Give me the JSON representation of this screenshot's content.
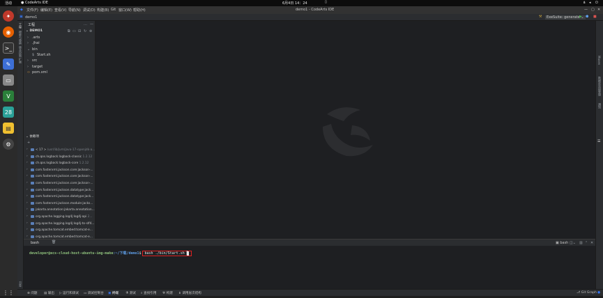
{
  "system_bar": {
    "activities": "活动",
    "app_name": "CodeArts IDE",
    "clock": "6月4日  14：24"
  },
  "window": {
    "title": "demo1 - CodeArts IDE"
  },
  "menu": {
    "items": [
      "文件(F)",
      "编辑(E)",
      "查看(V)",
      "导航(N)",
      "调试(D)",
      "构建(B)",
      "Git",
      "窗口(W)",
      "帮助(H)"
    ]
  },
  "toolbar": {
    "project_tab": "demo1",
    "run_config": "ExeSuite: generate"
  },
  "left_strip": {
    "labels": [
      "工程",
      "搜索与替换",
      "版本控制",
      "扩展"
    ],
    "bottom_label": "书签"
  },
  "right_strip": {
    "labels": [
      "Maven",
      "数据库连接管理",
      "通知"
    ]
  },
  "project": {
    "header": "工程",
    "root": "DEMO1",
    "tree": [
      {
        "name": ".arts",
        "kind": "folder",
        "indent": 0,
        "arrow": "›"
      },
      {
        "name": ".jhai",
        "kind": "folder",
        "indent": 0,
        "arrow": "›"
      },
      {
        "name": "bin",
        "kind": "folder",
        "indent": 0,
        "arrow": "⌄"
      },
      {
        "name": "Start.sh",
        "kind": "file",
        "indent": 1,
        "arrow": "$"
      },
      {
        "name": "src",
        "kind": "folder",
        "indent": 0,
        "arrow": "›"
      },
      {
        "name": "target",
        "kind": "folder",
        "indent": 0,
        "arrow": "›"
      },
      {
        "name": "pom.xml",
        "kind": "xml",
        "indent": 0,
        "arrow": "‹›"
      }
    ]
  },
  "deps": {
    "header": "依赖项",
    "items": [
      {
        "name": "< 17 > ",
        "version": "/usr/lib/jvm/java-17-openjdk-a..."
      },
      {
        "name": "ch.qos.logback:logback-classic ",
        "version": "1.2.12"
      },
      {
        "name": "ch.qos.logback:logback-core ",
        "version": "1.2.12"
      },
      {
        "name": "com.fasterxml.jackson.core:jackson-...",
        "version": ""
      },
      {
        "name": "com.fasterxml.jackson.core:jackson-...",
        "version": ""
      },
      {
        "name": "com.fasterxml.jackson.core:jackson-...",
        "version": ""
      },
      {
        "name": "com.fasterxml.jackson.datatype:jack...",
        "version": ""
      },
      {
        "name": "com.fasterxml.jackson.datatype:jack...",
        "version": ""
      },
      {
        "name": "com.fasterxml.jackson.module:jacks...",
        "version": ""
      },
      {
        "name": "jakarta.annotation:jakarta.annotation...",
        "version": ""
      },
      {
        "name": "org.apache.logging.log4j:log4j-api ",
        "version": "2..."
      },
      {
        "name": "org.apache.logging.log4j:log4j-to-slf4...",
        "version": ""
      },
      {
        "name": "org.apache.tomcat.embed:tomcat-e...",
        "version": ""
      },
      {
        "name": "org.apache.tomcat.embed:tomcat-e...",
        "version": ""
      }
    ]
  },
  "terminal": {
    "tab": "bash",
    "shell_label": "bash",
    "prompt_user": "developer@ecs-cloud-host-ubuntu-img-make",
    "prompt_path": ":~/下载/demo1",
    "prompt_symbol": "$",
    "command": "bash ./bin/Start.sh"
  },
  "statusbar": {
    "items": [
      "问题",
      "输出",
      "运行和调试",
      "调试控制台",
      "终端",
      "测试",
      "查找引用",
      "构建",
      "调用层次结构"
    ],
    "active": "终端",
    "right": "Git Graph"
  },
  "colors": {
    "accent": "#3574f0",
    "highlight_box": "#e02020",
    "prompt_green": "#8ec07c",
    "prompt_blue": "#5f9ee8"
  }
}
